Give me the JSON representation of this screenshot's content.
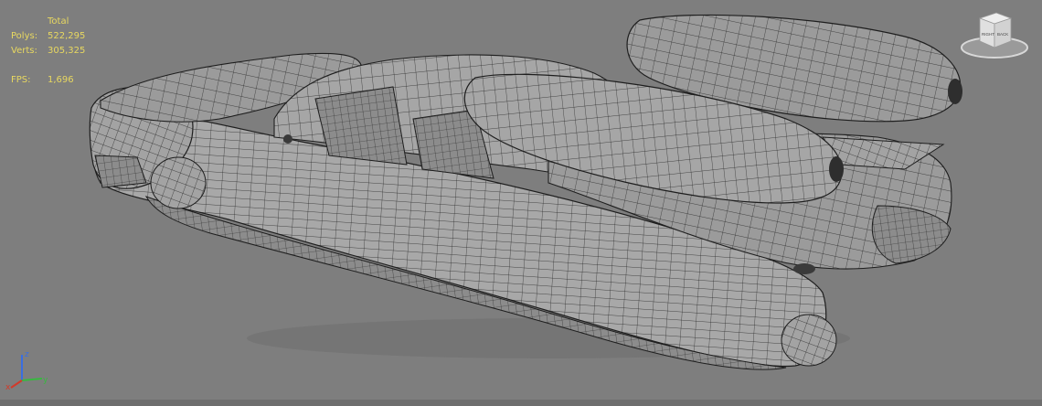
{
  "stats": {
    "header": "Total",
    "polys_label": "Polys:",
    "polys_value": "522,295",
    "verts_label": "Verts:",
    "verts_value": "305,325",
    "fps_label": "FPS:",
    "fps_value": "1,696"
  },
  "viewcube": {
    "face_label_left": "RIGHT",
    "face_label_right": "BACK"
  },
  "axis": {
    "x_label": "x",
    "y_label": "y",
    "z_label": "z"
  },
  "colors": {
    "stats_text": "#e8d860",
    "viewport_bg": "#7e7e7e",
    "mesh_fill": "#9a9a9a",
    "wire": "#2a2a2a",
    "axis_x": "#d23a2a",
    "axis_y": "#38b840",
    "axis_z": "#3a6ee0"
  }
}
